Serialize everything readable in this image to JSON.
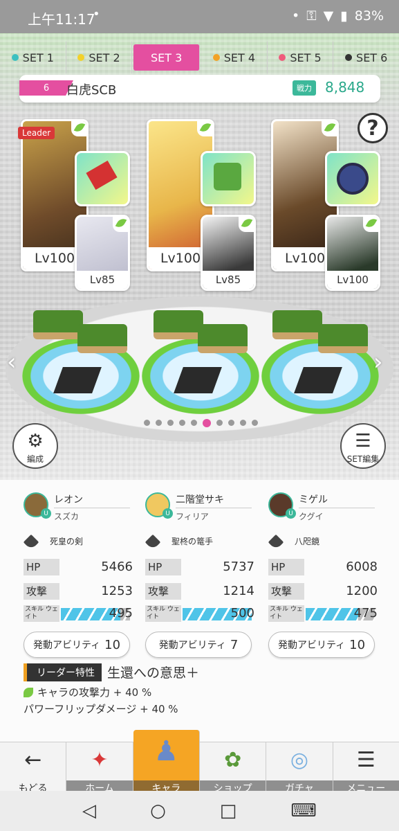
{
  "status": {
    "time": "上午11:17",
    "dot": "•",
    "battery": "83%"
  },
  "tabs": [
    {
      "label": "SET 1",
      "color": "#3cc0c0",
      "active": false
    },
    {
      "label": "SET 2",
      "color": "#f2d12b",
      "active": false
    },
    {
      "label": "SET 3",
      "color": "#ffffff",
      "active": true
    },
    {
      "label": "SET 4",
      "color": "#f2a227",
      "active": false
    },
    {
      "label": "SET 5",
      "color": "#ef5b7b",
      "active": false
    },
    {
      "label": "SET 6",
      "color": "#333333",
      "active": false
    }
  ],
  "team": {
    "number": "6",
    "name": "白虎SCB",
    "power_label": "戦力",
    "power_value": "8,848"
  },
  "help_icon": "?",
  "leader_tag": "Leader",
  "cards": [
    {
      "main_lv": "Lv100",
      "sub_lv": "Lv85",
      "item_color": "#e84a4a",
      "portrait_color": "#8a6a3a"
    },
    {
      "main_lv": "Lv100",
      "sub_lv": "Lv85",
      "item_color": "#5aa840",
      "portrait_color": "#f0c860"
    },
    {
      "main_lv": "Lv100",
      "sub_lv": "Lv100",
      "item_color": "#3a4a8a",
      "portrait_color": "#5a3a2a"
    }
  ],
  "buttons": {
    "formation": "編成",
    "set_edit": "SET編集"
  },
  "page_dots": {
    "count": 10,
    "active": 5
  },
  "characters": [
    {
      "name": "レオン",
      "sub": "スズカ",
      "equip": "死皇の剣",
      "hp": "5466",
      "atk": "1253",
      "wait": "495",
      "wait_level": 0.85,
      "ability_label": "発動アビリティ",
      "ability_count": "10"
    },
    {
      "name": "二階堂サキ",
      "sub": "フィリア",
      "equip": "聖柊の篭手",
      "hp": "5737",
      "atk": "1214",
      "wait": "500",
      "wait_level": 0.86,
      "ability_label": "発動アビリティ",
      "ability_count": "7"
    },
    {
      "name": "ミゲル",
      "sub": "クグイ",
      "equip": "八咫鏡",
      "hp": "6008",
      "atk": "1200",
      "wait": "475",
      "wait_level": 0.81,
      "ability_label": "発動アビリティ",
      "ability_count": "10"
    }
  ],
  "stat_labels": {
    "hp": "HP",
    "atk": "攻撃",
    "wait": "スキル ウェイト"
  },
  "leader_trait": {
    "tag": "リーダー特性",
    "title": "生還への意思＋",
    "line1": "キャラの攻撃力 + 40 %",
    "line2": "パワーフリップダメージ + 40 %"
  },
  "nav": [
    {
      "label": "もどる",
      "icon": "←"
    },
    {
      "label": "ホーム",
      "icon": "✦"
    },
    {
      "label": "キャラ",
      "icon": "♟"
    },
    {
      "label": "ショップ",
      "icon": "✿"
    },
    {
      "label": "ガチャ",
      "icon": "◎"
    },
    {
      "label": "メニュー",
      "icon": "☰"
    }
  ],
  "system": {
    "back": "◁",
    "home": "○",
    "recent": "□",
    "game": "⌨"
  }
}
